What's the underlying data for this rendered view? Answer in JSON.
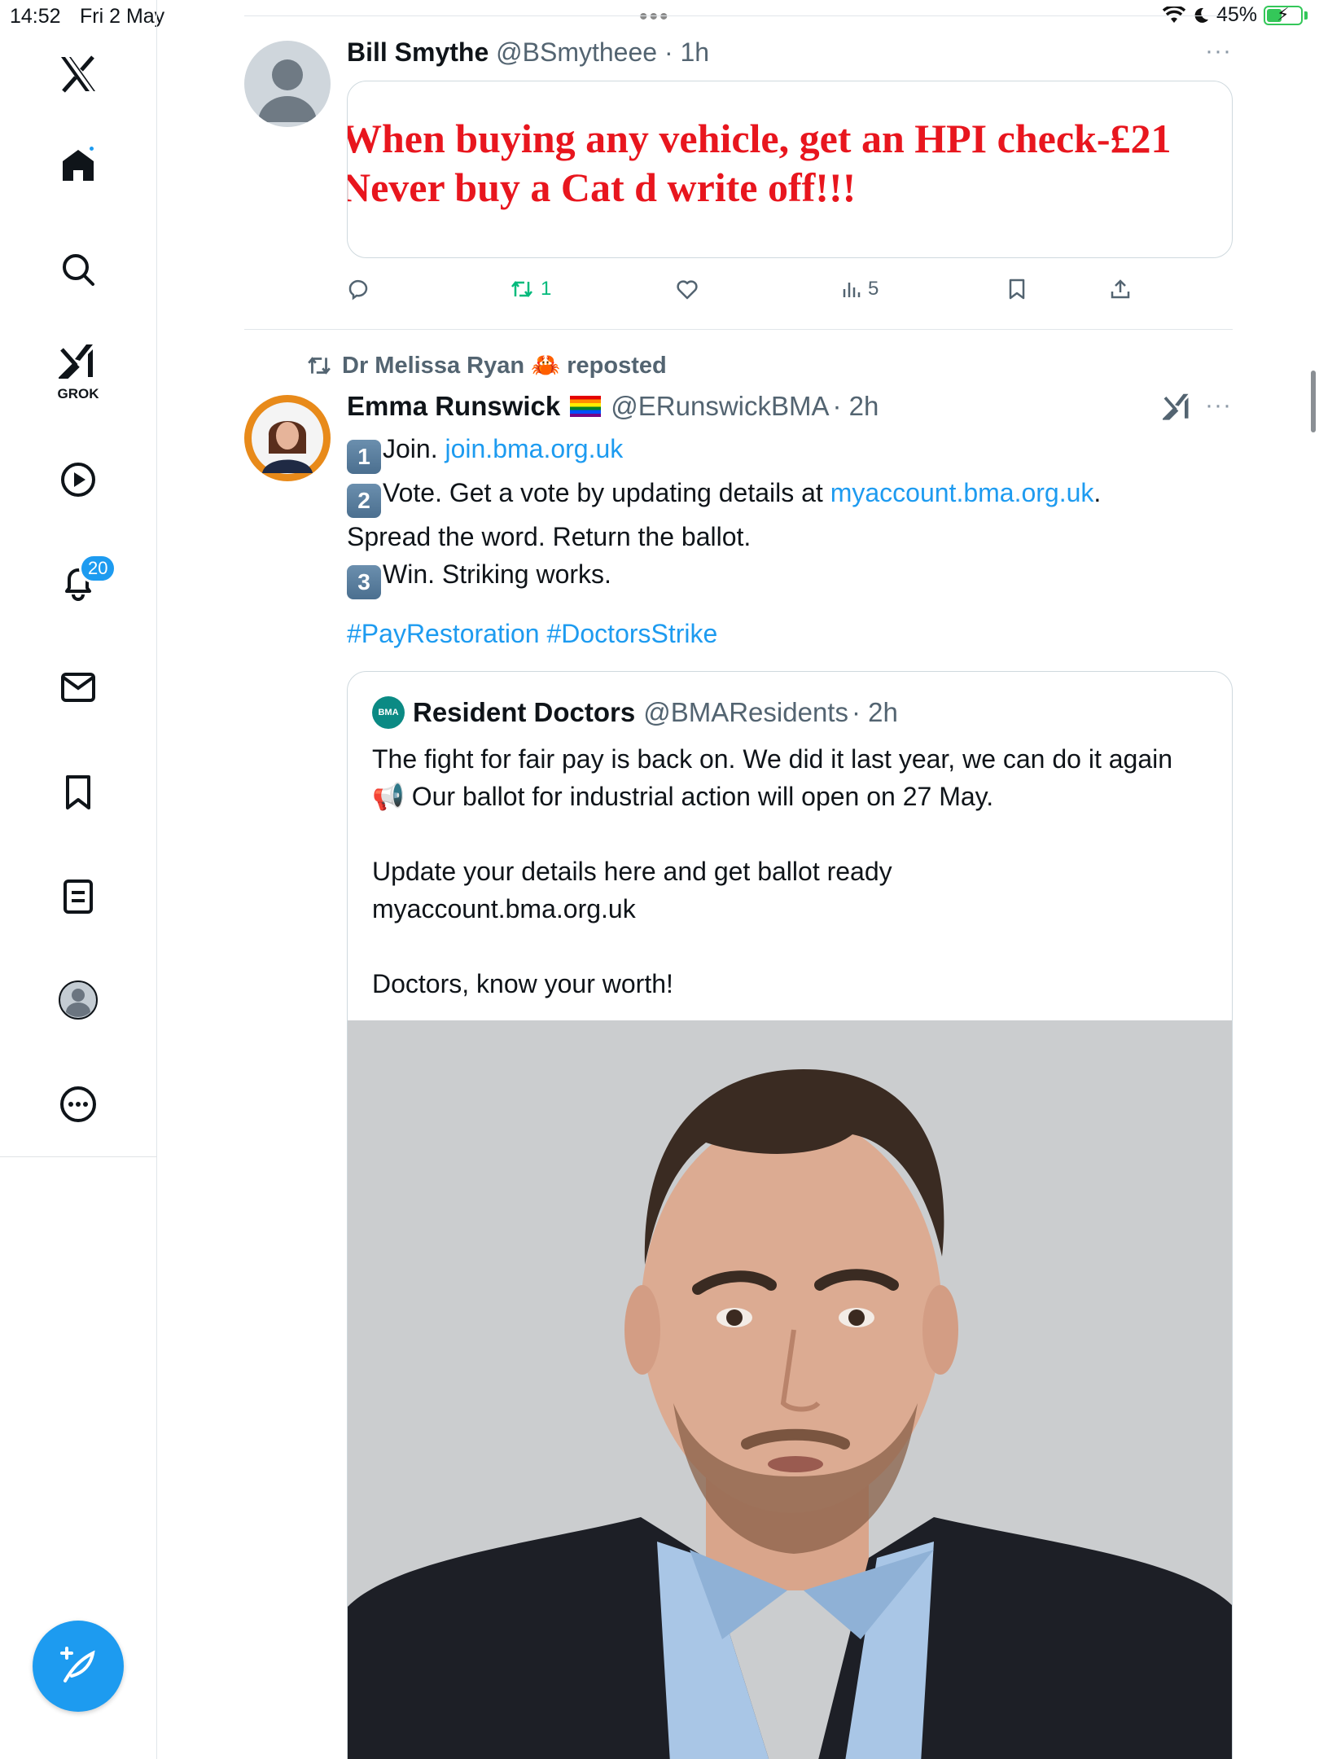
{
  "status_bar": {
    "time": "14:52",
    "date": "Fri 2 May",
    "battery": "45%",
    "battery_level": 0.45
  },
  "sidebar": {
    "grok_label": "GROK",
    "notifications_count": "20"
  },
  "tweet1": {
    "display_name": "Bill Smythe",
    "handle": "@BSmytheee",
    "time": "· 1h",
    "card_line1": "When buying any vehicle, get an HPI check-£21",
    "card_line2": "Never buy a Cat d write off!!!",
    "retweets": "1",
    "views": "5"
  },
  "tweet2": {
    "reposted_by": "Dr Melissa Ryan 🦀 reposted",
    "display_name": "Emma Runswick",
    "handle": "@ERunswickBMA",
    "time": "· 2h",
    "step1_num": "1",
    "step1_text": "Join. ",
    "step1_link": "join.bma.org.uk",
    "step2_num": "2",
    "step2_text": "Vote. Get a vote by updating details at ",
    "step2_link": "myaccount.bma.org.uk",
    "step2_end": ".",
    "line3": "Spread the word. Return the ballot.",
    "step3_num": "3",
    "step3_text": "Win. Striking works.",
    "hashtags": "#PayRestoration #DoctorsStrike"
  },
  "quote": {
    "logo_text": "BMA",
    "display_name": "Resident Doctors",
    "handle": "@BMAResidents",
    "time": "· 2h",
    "para1": "The fight for fair pay is back on. We did it last year, we can do it again 📢 Our ballot for industrial action will open on 27 May.",
    "para2_line1": "Update your details here and get ballot ready",
    "para2_line2": "myaccount.bma.org.uk",
    "para3": "Doctors, know your worth!"
  },
  "colors": {
    "accent": "#1d9bf0",
    "retweet": "#00ba7c",
    "text": "#0f1419",
    "muted": "#536471"
  }
}
